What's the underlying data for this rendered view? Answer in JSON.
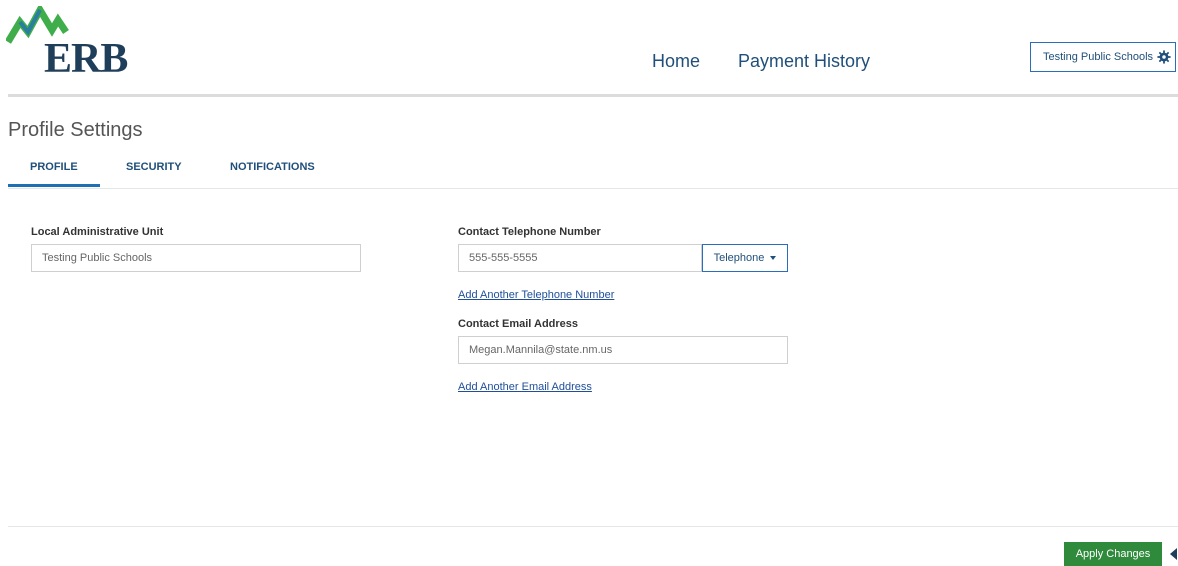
{
  "header": {
    "logo_text": "ERB",
    "nav": [
      {
        "label": "Home"
      },
      {
        "label": "Payment History"
      }
    ],
    "org_button_label": "Testing Public Schools"
  },
  "page": {
    "title": "Profile Settings",
    "tabs": [
      {
        "label": "PROFILE",
        "active": true
      },
      {
        "label": "SECURITY",
        "active": false
      },
      {
        "label": "NOTIFICATIONS",
        "active": false
      }
    ]
  },
  "form": {
    "local_admin_unit": {
      "label": "Local Administrative Unit",
      "value": "Testing Public Schools"
    },
    "phone": {
      "label": "Contact Telephone Number",
      "value": "555-555-5555",
      "type_selected": "Telephone",
      "add_link": "Add Another Telephone Number"
    },
    "email": {
      "label": "Contact Email Address",
      "value": "Megan.Mannila@state.nm.us",
      "add_link": "Add Another Email Address"
    }
  },
  "footer": {
    "apply_label": "Apply Changes"
  },
  "colors": {
    "brand_navy": "#1f3e5a",
    "brand_green": "#3fae4a",
    "link_blue": "#1f4f7a",
    "apply_green": "#2f8a3c"
  }
}
